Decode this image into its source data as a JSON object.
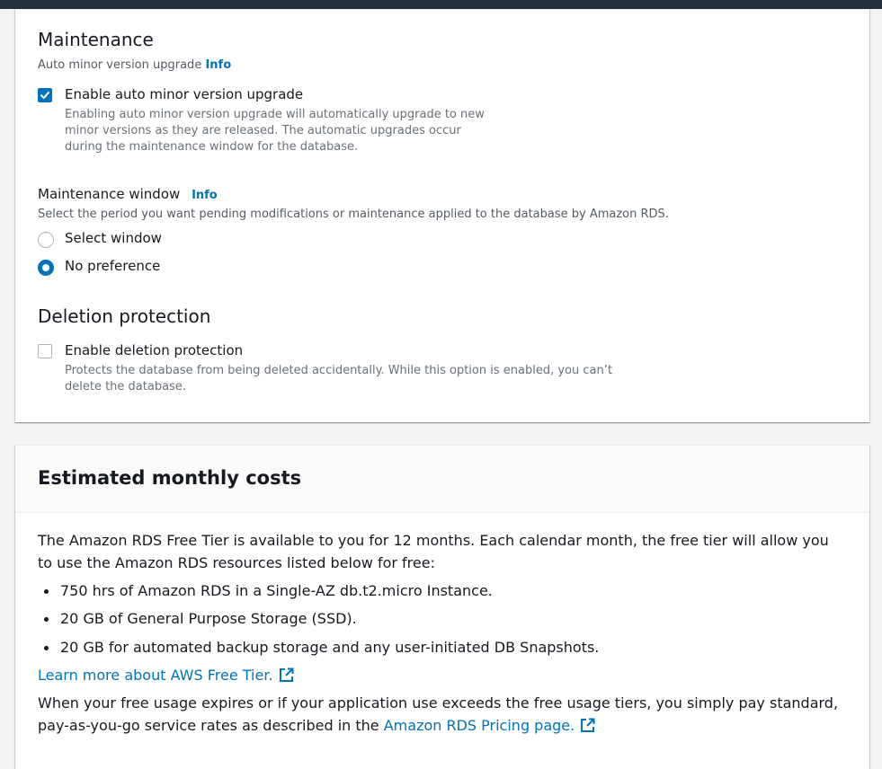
{
  "maintenance": {
    "title": "Maintenance",
    "auto_upgrade_label": "Auto minor version upgrade",
    "info": "Info",
    "enable_auto_upgrade": {
      "label": "Enable auto minor version upgrade",
      "checked": true,
      "description": "Enabling auto minor version upgrade will automatically upgrade to new minor versions as they are released. The automatic upgrades occur during the maintenance window for the database."
    },
    "window": {
      "label": "Maintenance window",
      "info": "Info",
      "description": "Select the period you want pending modifications or maintenance applied to the database by Amazon RDS.",
      "options": [
        {
          "label": "Select window",
          "selected": false
        },
        {
          "label": "No preference",
          "selected": true
        }
      ]
    }
  },
  "deletion": {
    "title": "Deletion protection",
    "enable": {
      "label": "Enable deletion protection",
      "checked": false,
      "description": "Protects the database from being deleted accidentally. While this option is enabled, you can’t delete the database."
    }
  },
  "costs": {
    "title": "Estimated monthly costs",
    "intro": "The Amazon RDS Free Tier is available to you for 12 months. Each calendar month, the free tier will allow you to use the Amazon RDS resources listed below for free:",
    "bullets": [
      "750 hrs of Amazon RDS in a Single-AZ db.t2.micro Instance.",
      "20 GB of General Purpose Storage (SSD).",
      "20 GB for automated backup storage and any user-initiated DB Snapshots."
    ],
    "learn_more_link": "Learn more about AWS Free Tier.",
    "footer_text": "When your free usage expires or if your application use exceeds the free usage tiers, you simply pay standard, pay-as-you-go service rates as described in the",
    "pricing_link": "Amazon RDS Pricing page."
  },
  "colors": {
    "accent": "#0073bb",
    "topbar": "#232f3e",
    "background": "#f2f3f3"
  }
}
